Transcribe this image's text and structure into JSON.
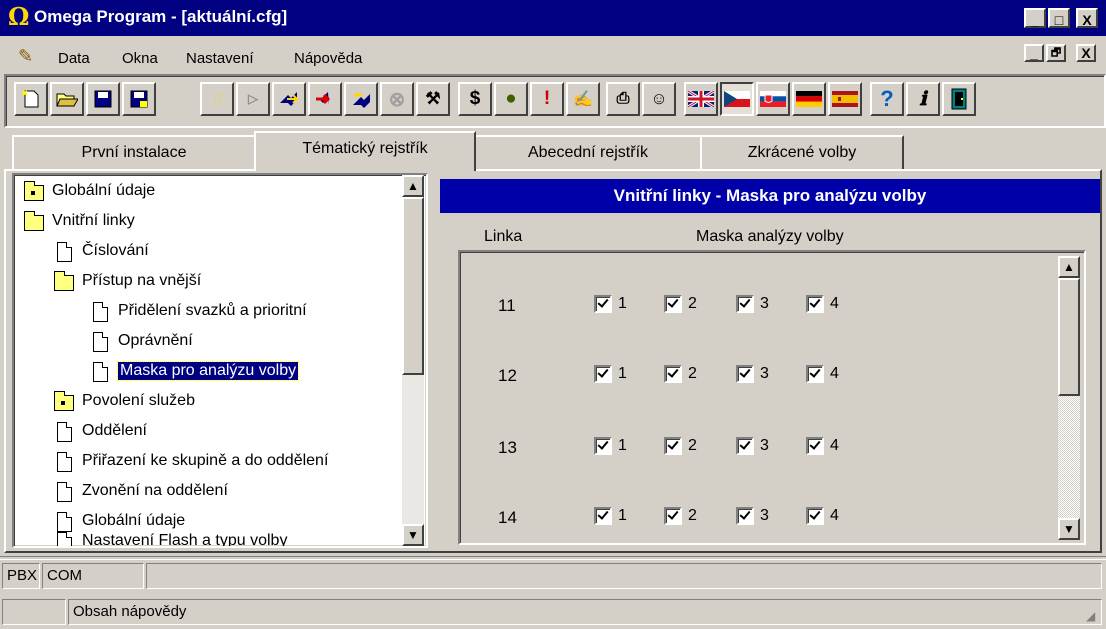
{
  "window": {
    "title": "Omega Program - [aktuální.cfg]",
    "app_icon": "omega-icon",
    "caption_buttons": [
      "_",
      "□",
      "X"
    ]
  },
  "menu": {
    "items": [
      "Data",
      "Okna",
      "Nastavení",
      "Nápověda"
    ],
    "mdi_buttons": [
      "_",
      "🗗",
      "X"
    ]
  },
  "toolbar": {
    "buttons": [
      "new",
      "open",
      "save",
      "save-as",
      "connect",
      "play",
      "send",
      "receive",
      "stop",
      "settings",
      "cost",
      "plug",
      "alarm",
      "edit",
      "print",
      "user",
      "flag-uk",
      "flag-cz",
      "flag-sk",
      "flag-de",
      "flag-es",
      "help",
      "info",
      "exit"
    ],
    "glyphs": {
      "cost": "$",
      "help": "?",
      "info": "ℹ"
    }
  },
  "tabs": [
    "První instalace",
    "Tématický rejstřík",
    "Abecední rejstřík",
    "Zkrácené volby"
  ],
  "active_tab": 1,
  "tree": {
    "nodes": [
      {
        "label": "Globální údaje",
        "type": "folder-closed",
        "level": 0
      },
      {
        "label": "Vnitřní linky",
        "type": "folder-open",
        "level": 0
      },
      {
        "label": "Číslování",
        "type": "page",
        "level": 1
      },
      {
        "label": "Přístup na vnější",
        "type": "folder-open",
        "level": 1
      },
      {
        "label": "Přidělení svazků a prioritní",
        "type": "page",
        "level": 2
      },
      {
        "label": "Oprávnění",
        "type": "page",
        "level": 2
      },
      {
        "label": "Maska pro analýzu volby",
        "type": "page",
        "level": 2,
        "selected": true
      },
      {
        "label": "Povolení služeb",
        "type": "folder-closed",
        "level": 1
      },
      {
        "label": "Oddělení",
        "type": "page",
        "level": 1
      },
      {
        "label": "Přiřazení ke skupině a do oddělení",
        "type": "page",
        "level": 1
      },
      {
        "label": "Zvonění na oddělení",
        "type": "page",
        "level": 1
      },
      {
        "label": "Globální údaje",
        "type": "page",
        "level": 1
      },
      {
        "label": "Nastavení Flash a typu volby",
        "type": "page",
        "level": 1
      }
    ]
  },
  "panel": {
    "title": "Vnitřní linky - Maska pro analýzu volby",
    "col_linka": "Linka",
    "col_mask": "Maska analýzy volby",
    "rows": [
      {
        "line": "11",
        "checks": [
          "1",
          "2",
          "3",
          "4"
        ]
      },
      {
        "line": "12",
        "checks": [
          "1",
          "2",
          "3",
          "4"
        ]
      },
      {
        "line": "13",
        "checks": [
          "1",
          "2",
          "3",
          "4"
        ]
      },
      {
        "line": "14",
        "checks": [
          "1",
          "2",
          "3",
          "4"
        ]
      }
    ]
  },
  "status": {
    "pbx": "PBX",
    "com": "COM",
    "help_text": "Obsah nápovědy"
  }
}
